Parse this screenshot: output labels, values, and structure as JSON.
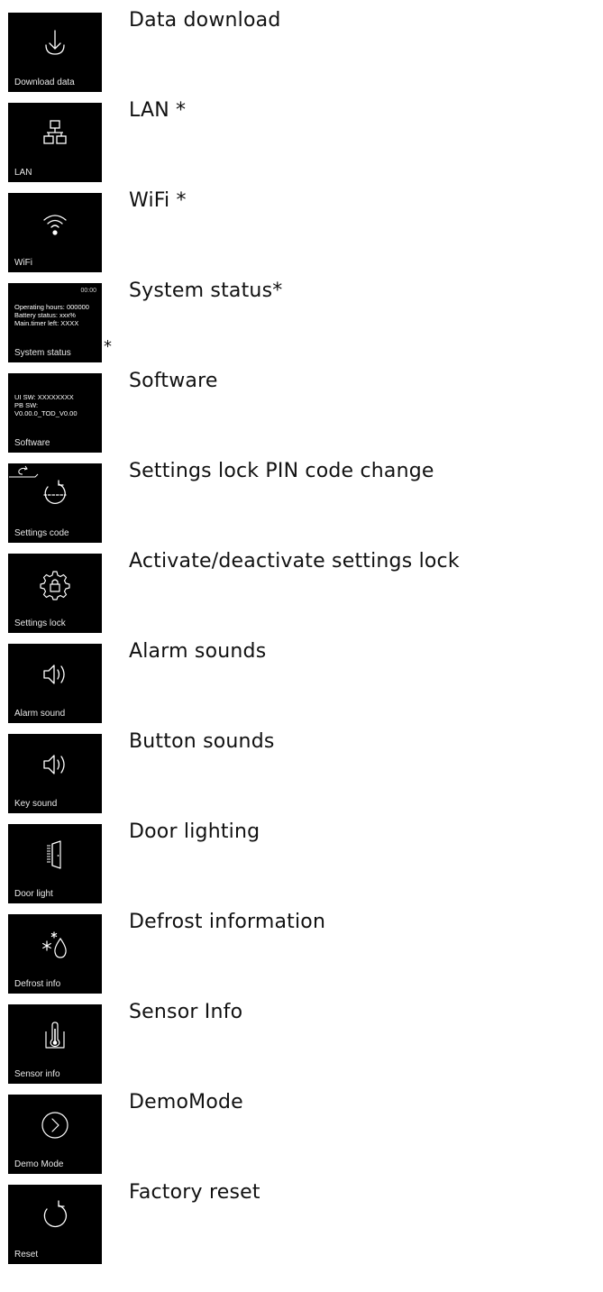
{
  "colors": {
    "tile_background": "#000000",
    "tile_text": "#ffffff",
    "page_background": "#ffffff",
    "title_text": "#111111"
  },
  "items": [
    {
      "id": "download",
      "icon": "download-icon",
      "tile_label": "Download data",
      "title": "Data download"
    },
    {
      "id": "lan",
      "icon": "lan-network-icon",
      "tile_label": "LAN",
      "title": "LAN *"
    },
    {
      "id": "wifi",
      "icon": "wifi-icon",
      "tile_label": "WiFi",
      "title": "WiFi *"
    },
    {
      "id": "system-status",
      "icon": "",
      "tile_label": "System status",
      "title": "System status*",
      "time": "00:00",
      "lines": [
        "Operating hours: 000000",
        "Battery status: xxx%",
        "Main.timer left: XXXX"
      ],
      "note": "*"
    },
    {
      "id": "software",
      "icon": "",
      "tile_label": "Software",
      "title": "Software",
      "lines": [
        "UI SW: XXXXXXXX",
        "PB SW:",
        "V0.00.0_TOD_V0.00"
      ]
    },
    {
      "id": "settings-code",
      "icon": "settings-code-icon",
      "tile_label": "Settings code",
      "title": "Settings lock PIN code change"
    },
    {
      "id": "settings-lock",
      "icon": "gear-lock-icon",
      "tile_label": "Settings lock",
      "title": "Activate/deactivate settings lock"
    },
    {
      "id": "alarm-sound",
      "icon": "speaker-icon",
      "tile_label": "Alarm sound",
      "title": "Alarm sounds"
    },
    {
      "id": "key-sound",
      "icon": "speaker-icon",
      "tile_label": "Key sound",
      "title": "Button sounds"
    },
    {
      "id": "door-light",
      "icon": "door-light-icon",
      "tile_label": "Door light",
      "title": "Door lighting"
    },
    {
      "id": "defrost-info",
      "icon": "defrost-icon",
      "tile_label": "Defrost info",
      "title": "Defrost information"
    },
    {
      "id": "sensor-info",
      "icon": "thermometer-icon",
      "tile_label": "Sensor info",
      "title": "Sensor Info"
    },
    {
      "id": "demo-mode",
      "icon": "play-circle-icon",
      "tile_label": "Demo Mode",
      "title": "DemoMode"
    },
    {
      "id": "reset",
      "icon": "reset-icon",
      "tile_label": "Reset",
      "title": "Factory reset"
    }
  ]
}
